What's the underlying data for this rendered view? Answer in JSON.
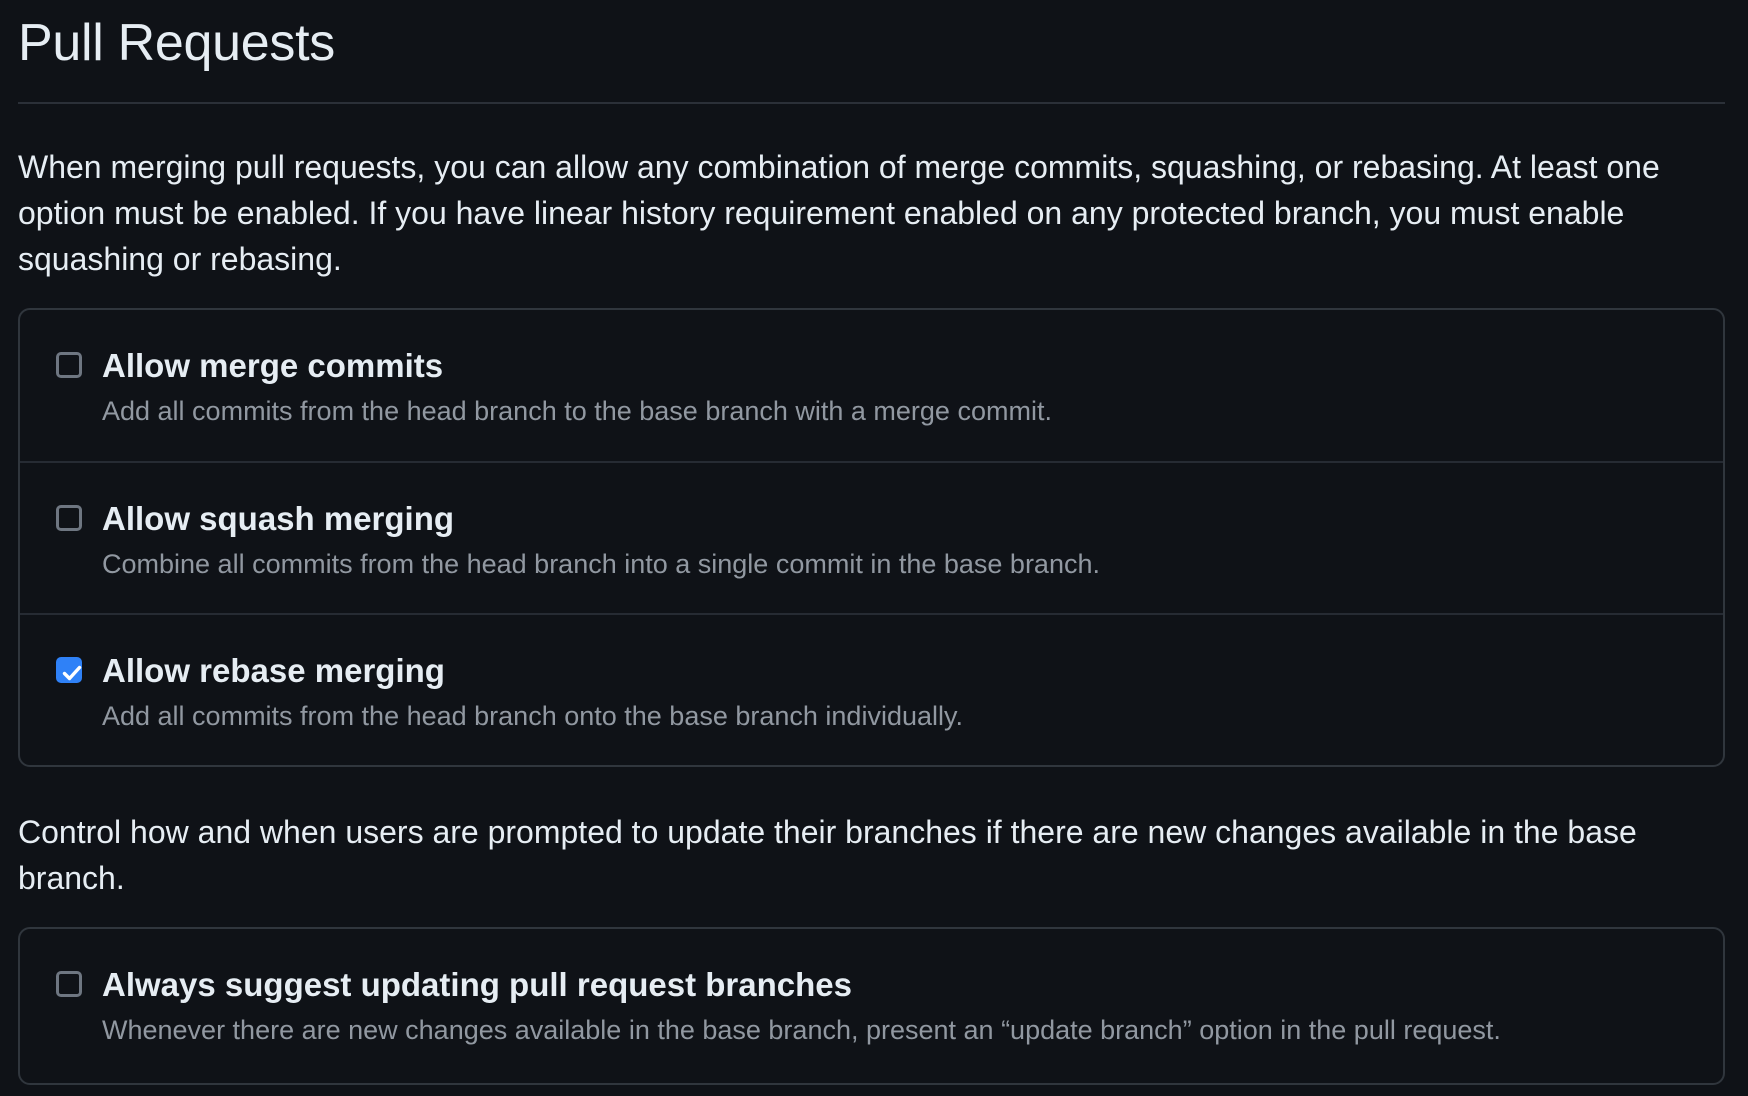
{
  "page": {
    "title": "Pull Requests",
    "intro": "When merging pull requests, you can allow any combination of merge commits, squashing, or rebasing. At least one option must be enabled. If you have linear history requirement enabled on any protected branch, you must enable squashing or rebasing."
  },
  "merge_options": [
    {
      "label": "Allow merge commits",
      "description": "Add all commits from the head branch to the base branch with a merge commit.",
      "checked": false
    },
    {
      "label": "Allow squash merging",
      "description": "Combine all commits from the head branch into a single commit in the base branch.",
      "checked": false
    },
    {
      "label": "Allow rebase merging",
      "description": "Add all commits from the head branch onto the base branch individually.",
      "checked": true
    }
  ],
  "update": {
    "intro": "Control how and when users are prompted to update their branches if there are new changes available in the base branch.",
    "option": {
      "label": "Always suggest updating pull request branches",
      "description": "Whenever there are new changes available in the base branch, present an “update branch” option in the pull request.",
      "checked": false
    }
  },
  "icons": {
    "checkbox_checked": "check-icon"
  },
  "colors": {
    "background": "#0f1217",
    "text_primary": "#e6edf3",
    "text_muted": "#9198a1",
    "border": "#30363d",
    "accent": "#2f81f7"
  }
}
